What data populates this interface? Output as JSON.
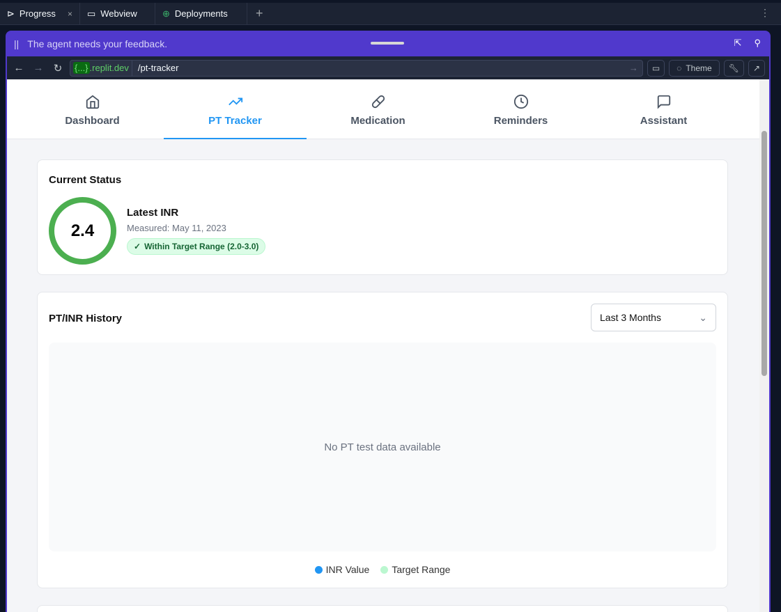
{
  "tabs": [
    {
      "label": "Progress",
      "icon": "progress-icon"
    },
    {
      "label": "Webview",
      "icon": "monitor-icon"
    },
    {
      "label": "Deployments",
      "icon": "deploy-icon"
    }
  ],
  "feedback": {
    "message": "The agent needs your feedback."
  },
  "urlbar": {
    "domain_token": "{...}",
    "domain": ".replit.dev",
    "path": "/pt-tracker",
    "theme_label": "Theme"
  },
  "nav": [
    {
      "label": "Dashboard"
    },
    {
      "label": "PT Tracker"
    },
    {
      "label": "Medication"
    },
    {
      "label": "Reminders"
    },
    {
      "label": "Assistant"
    }
  ],
  "status": {
    "title": "Current Status",
    "value": "2.4",
    "label": "Latest INR",
    "measured": "Measured: May 11, 2023",
    "badge": "Within Target Range (2.0-3.0)"
  },
  "history": {
    "title": "PT/INR History",
    "range": "Last 3 Months",
    "empty": "No PT test data available",
    "legend": [
      {
        "label": "INR Value",
        "color": "#2196f3"
      },
      {
        "label": "Target Range",
        "color": "#bbf7d0"
      }
    ]
  }
}
